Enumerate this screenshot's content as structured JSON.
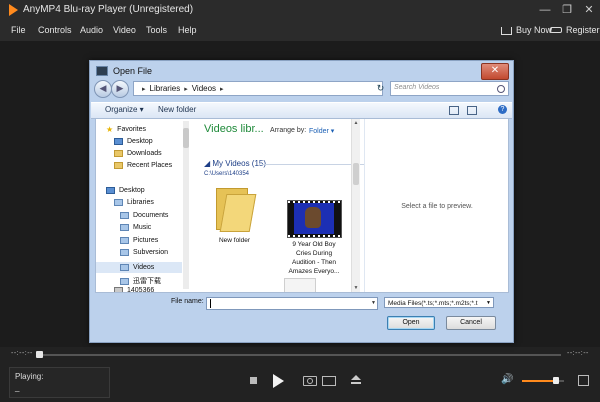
{
  "app": {
    "title": "AnyMP4 Blu-ray Player (Unregistered)",
    "window_controls": [
      "—",
      "❐",
      "✕"
    ],
    "menu": [
      "File",
      "Controls",
      "Audio",
      "Video",
      "Tools",
      "Help"
    ],
    "buy_label": "Buy Now",
    "register_label": "Register",
    "accent_color": "#ff8a1d"
  },
  "dialog": {
    "title": "Open File",
    "close_label": "✕",
    "breadcrumb": [
      "Libraries",
      "Videos"
    ],
    "search_placeholder": "Search Videos",
    "toolbar": {
      "organize": "Organize ▾",
      "new_folder": "New folder",
      "view_icon": "views-icon",
      "help": "?"
    },
    "nav_tree": [
      {
        "label": "Favorites",
        "icon": "star-icon"
      },
      {
        "label": "Desktop",
        "icon": "desktop-icon"
      },
      {
        "label": "Downloads",
        "icon": "folder-icon"
      },
      {
        "label": "Recent Places",
        "icon": "folder-icon"
      },
      {
        "label": "Desktop",
        "icon": "desktop-icon"
      },
      {
        "label": "Libraries",
        "icon": "library-icon"
      },
      {
        "label": "Documents",
        "icon": "library-icon"
      },
      {
        "label": "Music",
        "icon": "library-icon"
      },
      {
        "label": "Pictures",
        "icon": "library-icon"
      },
      {
        "label": "Subversion",
        "icon": "library-icon"
      },
      {
        "label": "Videos",
        "icon": "library-icon"
      },
      {
        "label": "迅雷下载",
        "icon": "library-icon"
      },
      {
        "label": "1405366",
        "icon": "pc-icon"
      }
    ],
    "library_title": "Videos libr...",
    "arrange_label": "Arrange by:",
    "arrange_value": "Folder ▾",
    "group_header": "My Videos (15)",
    "group_path": "C:\\Users\\140354",
    "files": [
      {
        "label": "New folder"
      },
      {
        "label_lines": [
          "9 Year Old Boy",
          "Cries During",
          "Audition - Then",
          "Amazes Everyo..."
        ]
      }
    ],
    "preview_text": "Select a file to preview.",
    "file_name_label": "File name:",
    "file_name_value": "",
    "file_type_value": "Media Files(*.ts;*.mts;*.m2ts;*.t",
    "open_label": "Open",
    "cancel_label": "Cancel"
  },
  "player": {
    "time_elapsed": "--:--:--",
    "time_total": "--:--:--",
    "progress": 0,
    "playing_label": "Playing:",
    "playing_value": "_",
    "volume": 0.8
  }
}
